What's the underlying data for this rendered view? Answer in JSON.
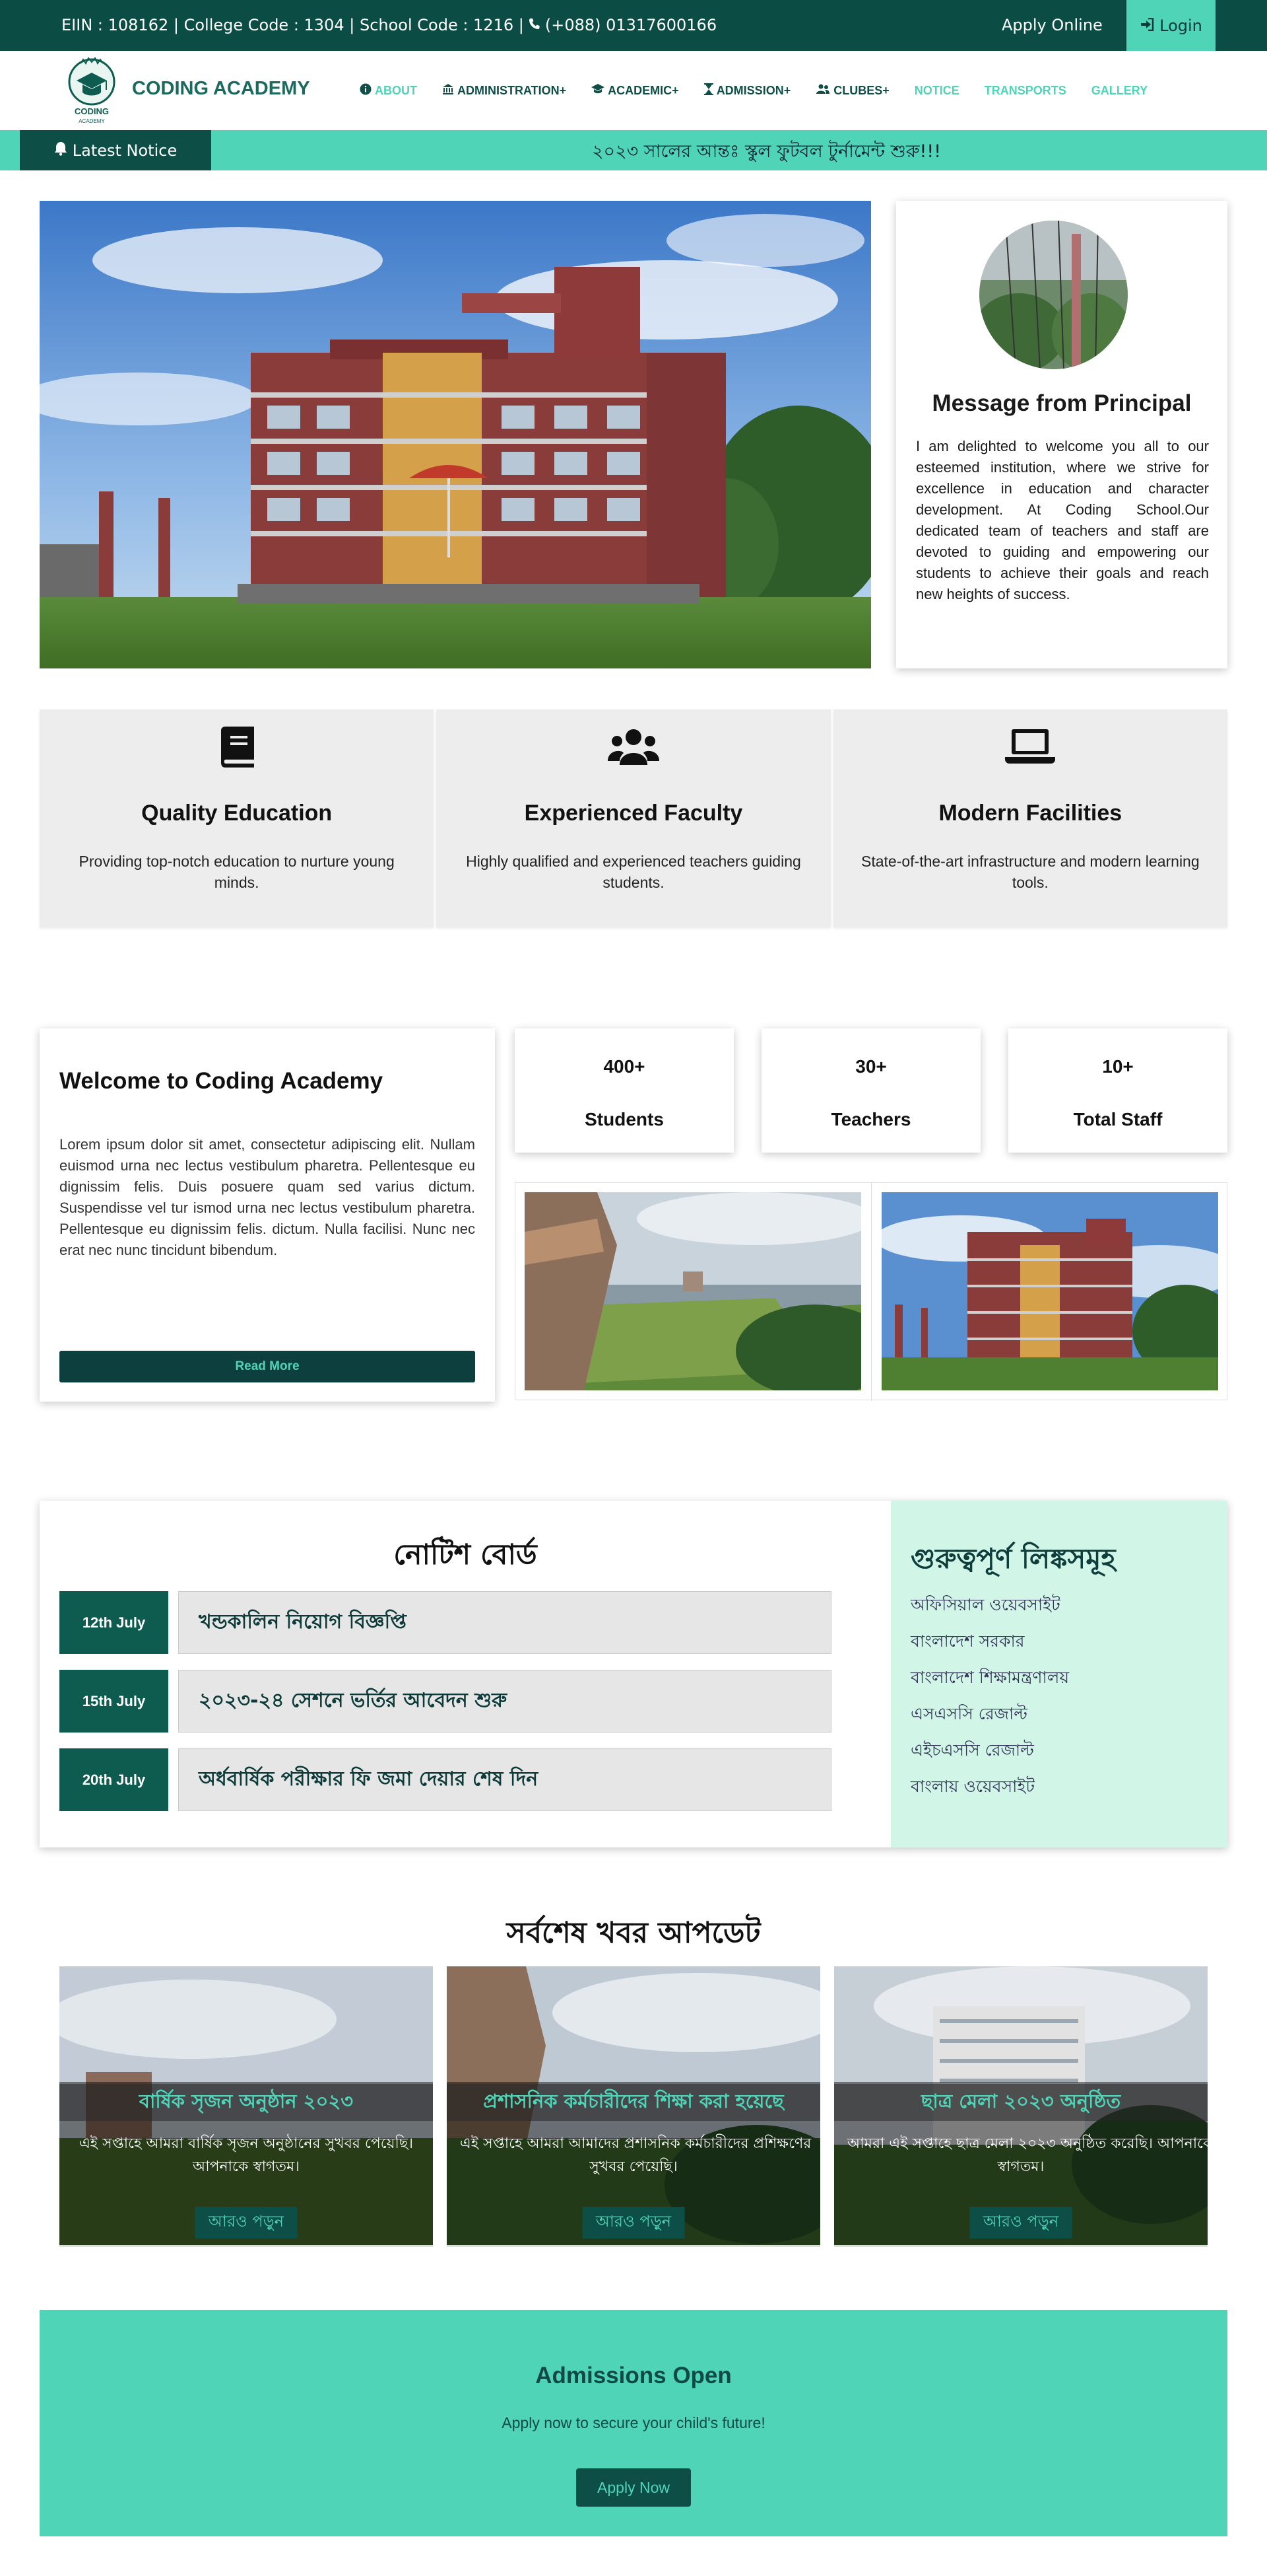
{
  "topbar": {
    "info": "EIIN : 108162 | College Code : 1304 | School Code : 1216 |",
    "phone": "(+088) 01317600166",
    "apply_online": "Apply Online",
    "login": "Login"
  },
  "nav": {
    "brand": "CODING ACADEMY",
    "logo_text": "CODING",
    "logo_subtext": "ACADEMY",
    "items": [
      {
        "label": "ABOUT",
        "icon": "info-icon"
      },
      {
        "label": "ADMINISTRATION+",
        "icon": "institution-icon"
      },
      {
        "label": "ACADEMIC+",
        "icon": "graduation-cap-icon"
      },
      {
        "label": "ADMISSION+",
        "icon": "hourglass-icon"
      },
      {
        "label": "CLUBES+",
        "icon": "users-icon"
      },
      {
        "label": "NOTICE"
      },
      {
        "label": "TRANSPORTS"
      },
      {
        "label": "GALLERY"
      }
    ]
  },
  "notice_bar": {
    "label": "Latest Notice",
    "text": "২০২৩ সালের আন্তঃ স্কুল ফুটবল টুর্নামেন্ট শুরু!!!"
  },
  "principal": {
    "title": "Message from Principal",
    "message": "I am delighted to welcome you all to our esteemed institution, where we strive for excellence in education and character development. At Coding School.Our dedicated team of teachers and staff are devoted to guiding and empowering our students to achieve their goals and reach new heights of success."
  },
  "features": [
    {
      "icon": "book-icon",
      "title": "Quality Education",
      "text": "Providing top-notch education to nurture young minds."
    },
    {
      "icon": "users-icon",
      "title": "Experienced Faculty",
      "text": "Highly qualified and experienced teachers guiding students."
    },
    {
      "icon": "laptop-icon",
      "title": "Modern Facilities",
      "text": "State-of-the-art infrastructure and modern learning tools."
    }
  ],
  "welcome": {
    "title": "Welcome to Coding Academy",
    "text": "Lorem ipsum dolor sit amet, consectetur adipiscing elit. Nullam euismod urna nec lectus vestibulum pharetra. Pellentesque eu dignissim felis. Duis posuere quam sed varius dictum. Suspendisse vel tur ismod urna nec lectus vestibulum pharetra. Pellentesque eu dignissim felis. dictum. Nulla facilisi. Nunc nec erat nec nunc tincidunt bibendum.",
    "button": "Read More"
  },
  "stats": [
    {
      "num": "400+",
      "label": "Students"
    },
    {
      "num": "30+",
      "label": "Teachers"
    },
    {
      "num": "10+",
      "label": "Total Staff"
    }
  ],
  "noticeboard": {
    "title": "নোটিশ বোর্ড",
    "items": [
      {
        "date": "12th July",
        "title": "খন্ডকালিন নিয়োগ বিজ্ঞপ্তি"
      },
      {
        "date": "15th July",
        "title": "২০২৩-২৪ সেশনে ভর্তির আবেদন শুরু"
      },
      {
        "date": "20th July",
        "title": "অর্ধবার্ষিক পরীক্ষার ফি জমা দেয়ার শেষ দিন"
      }
    ]
  },
  "links": {
    "title": "গুরুত্বপূর্ণ লিঙ্কসমূহ",
    "items": [
      "অফিসিয়াল ওয়েবসাইট",
      "বাংলাদেশ সরকার",
      "বাংলাদেশ শিক্ষামন্ত্রণালয়",
      "এসএসসি রেজাল্ট",
      "এইচএসসি রেজাল্ট",
      "বাংলায় ওয়েবসাইট"
    ]
  },
  "news": {
    "title": "সর্বশেষ খবর আপডেট",
    "items": [
      {
        "title": "বার্ষিক সৃজন অনুষ্ঠান ২০২৩",
        "line1": "এই সপ্তাহে আমরা বার্ষিক সৃজন অনুষ্ঠানের সুখবর পেয়েছি।",
        "line2": "আপনাকে স্বাগতম।",
        "button": "আরও পড়ুন"
      },
      {
        "title": "প্রশাসনিক কর্মচারীদের শিক্ষা করা হয়েছে",
        "line1": "এই সপ্তাহে আমরা আমাদের প্রশাসনিক কর্মচারীদের প্রশিক্ষণের",
        "line2": "সুখবর পেয়েছি।",
        "button": "আরও পড়ুন"
      },
      {
        "title": "ছাত্র মেলা ২০২৩ অনুষ্ঠিত",
        "line1": "আমরা এই সপ্তাহে ছাত্র মেলা ২০২৩ অনুষ্ঠিত করেছি। আপনাকে",
        "line2": "স্বাগতম।",
        "button": "আরও পড়ুন"
      }
    ]
  },
  "admissions": {
    "title": "Admissions Open",
    "text": "Apply now to secure your child's future!",
    "button": "Apply Now"
  }
}
